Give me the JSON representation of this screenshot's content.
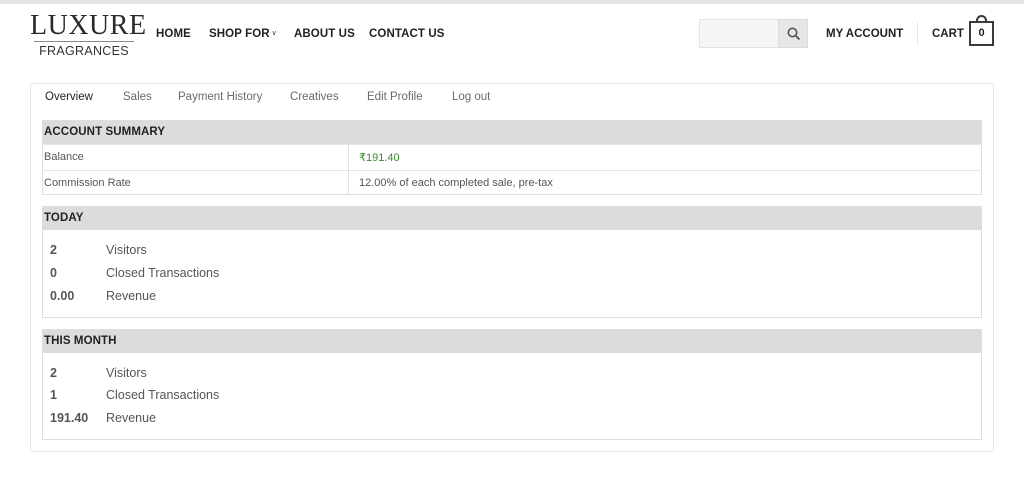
{
  "brand": {
    "name": "LUXURE",
    "sub": "FRAGRANCES"
  },
  "nav": {
    "home": "HOME",
    "shop": "SHOP FOR",
    "about": "ABOUT US",
    "contact": "CONTACT US"
  },
  "search": {
    "placeholder": ""
  },
  "header": {
    "my_account": "MY ACCOUNT",
    "cart": "CART",
    "cart_count": "0"
  },
  "tabs": [
    {
      "label": "Overview",
      "active": true
    },
    {
      "label": "Sales"
    },
    {
      "label": "Payment History"
    },
    {
      "label": "Creatives"
    },
    {
      "label": "Edit Profile"
    },
    {
      "label": "Log out"
    }
  ],
  "summary": {
    "title": "ACCOUNT SUMMARY",
    "rows": [
      {
        "key": "Balance",
        "value": "₹191.40"
      },
      {
        "key": "Commission Rate",
        "value": "12.00% of each completed sale, pre-tax"
      }
    ]
  },
  "today": {
    "title": "TODAY",
    "stats": [
      {
        "value": "2",
        "label": "Visitors"
      },
      {
        "value": "0",
        "label": "Closed Transactions"
      },
      {
        "value": "0.00",
        "label": "Revenue"
      }
    ]
  },
  "month": {
    "title": "THIS MONTH",
    "stats": [
      {
        "value": "2",
        "label": "Visitors"
      },
      {
        "value": "1",
        "label": "Closed Transactions"
      },
      {
        "value": "191.40",
        "label": "Revenue"
      }
    ]
  }
}
